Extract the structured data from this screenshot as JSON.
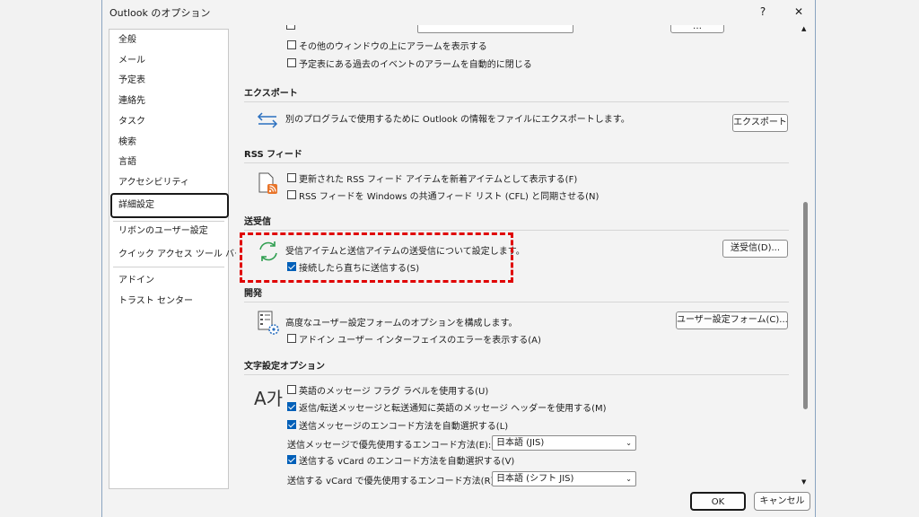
{
  "window": {
    "title": "Outlook のオプション",
    "help": "?",
    "close": "✕"
  },
  "nav": {
    "items": [
      "全般",
      "メール",
      "予定表",
      "連絡先",
      "タスク",
      "検索",
      "言語",
      "アクセシビリティ",
      "詳細設定",
      "リボンのユーザー設定",
      "クイック アクセス ツール バー",
      "アドイン",
      "トラスト センター"
    ],
    "selected": "詳細設定"
  },
  "top": {
    "alarm_other_windows": "その他のウィンドウの上にアラームを表示する",
    "close_past_alarms": "予定表にある過去のイベントのアラームを自動的に閉じる",
    "partial_button": "…"
  },
  "export": {
    "heading": "エクスポート",
    "description": "別のプログラムで使用するために Outlook の情報をファイルにエクスポートします。",
    "button": "エクスポート"
  },
  "rss": {
    "heading": "RSS フィード",
    "option1": "更新された RSS フィード アイテムを新着アイテムとして表示する(F)",
    "option2": "RSS フィードを Windows の共通フィード リスト (CFL) と同期させる(N)"
  },
  "sendrecv": {
    "heading": "送受信",
    "description": "受信アイテムと送信アイテムの送受信について設定します。",
    "button": "送受信(D)...",
    "option_send_immediately": "接続したら直ちに送信する(S)"
  },
  "dev": {
    "heading": "開発",
    "description": "高度なユーザー設定フォームのオプションを構成します。",
    "button": "ユーザー設定フォーム(C)...",
    "option_addin_errors": "アドイン ユーザー インターフェイスのエラーを表示する(A)"
  },
  "intl": {
    "heading": "文字設定オプション",
    "icon_text": "A가",
    "opt1": "英語のメッセージ フラグ ラベルを使用する(U)",
    "opt2": "返信/転送メッセージと転送通知に英語のメッセージ ヘッダーを使用する(M)",
    "opt3": "送信メッセージのエンコード方法を自動選択する(L)",
    "encoding_label": "送信メッセージで優先使用するエンコード方法(E):",
    "encoding_value": "日本語 (JIS)",
    "opt4": "送信する vCard のエンコード方法を自動選択する(V)",
    "vcard_label": "送信する vCard で優先使用するエンコード方法(R):",
    "vcard_value": "日本語 (シフト JIS)"
  },
  "footer": {
    "ok": "OK",
    "cancel": "キャンセル"
  },
  "colors": {
    "accent": "#005fb8",
    "highlight": "#e00000",
    "sync_icon": "#2e9e4f",
    "rss_icon": "#e8742a"
  }
}
